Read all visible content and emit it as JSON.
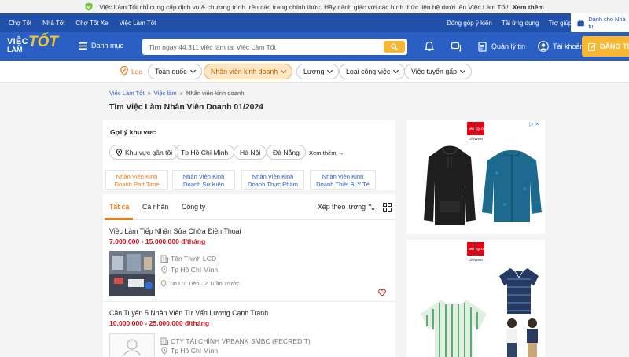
{
  "banner": {
    "text": "Việc Làm Tốt chỉ cung cấp dịch vụ & chương trình trên các trang chính thức. Hãy cảnh giác với các hình thức liên hệ dưới tên Việc Làm Tốt!",
    "more": "Xem thêm"
  },
  "topnav": {
    "left": [
      "Chợ Tốt",
      "Nhà Tốt",
      "Chợ Tốt Xe",
      "Việc Làm Tốt"
    ],
    "right": [
      "Đóng góp ý kiến",
      "Tải ứng dụng",
      "Trợ giúp"
    ],
    "employer": "Dành cho Nhà tu"
  },
  "header": {
    "logo_a": "VIỆC",
    "logo_b": "LÀM",
    "logo_c": "TỐT",
    "menu": "Danh mục",
    "search_placeholder": "Tìm ngay 44.311 việc làm tại Việc Làm Tốt",
    "manage": "Quản lý tin",
    "account": "Tài khoản",
    "post": "ĐĂNG TI"
  },
  "filters": {
    "location_label": "Lọc",
    "chips": [
      "Toàn quốc",
      "Nhân viên kinh doanh",
      "Lương",
      "Loại công việc",
      "Việc tuyển gấp"
    ]
  },
  "breadcrumb": [
    "Việc Làm Tốt",
    "Việc làm",
    "Nhân viên kinh doanh"
  ],
  "page_title": "Tìm Việc Làm Nhân Viên Doanh 01/2024",
  "suggest": {
    "heading": "Gợi ý khu vực",
    "regions": [
      "Khu vực gần tôi",
      "Tp Hồ Chí Minh",
      "Hà Nội",
      "Đà Nẵng"
    ],
    "more": "Xem thêm",
    "cards": [
      {
        "l1": "Nhân Viên Kinh",
        "l2": "Doanh Part Time"
      },
      {
        "l1": "Nhân Viên Kinh",
        "l2": "Doanh Sự Kiện"
      },
      {
        "l1": "Nhân Viên Kinh",
        "l2": "Doanh Thực Phẩm"
      },
      {
        "l1": "Nhân Viên Kinh",
        "l2": "Doanh Thiết Bị Y Tế"
      }
    ]
  },
  "tabs": [
    "Tất cả",
    "Cá nhân",
    "Công ty"
  ],
  "sort_label": "Xếp theo lương",
  "jobs": [
    {
      "title": "Việc Làm Tiếp Nhận Sửa Chữa Điện Thoại",
      "salary": "7.000.000 - 15.000.000 đ/tháng",
      "company": "Tân Thịnh LCD",
      "location": "Tp Hồ Chí Minh",
      "meta": "Tin Ưu Tiên · 2 Tuần Trước"
    },
    {
      "title": "Cần Tuyển 5 Nhân Viên Tư Vấn Lương Cạnh Tranh",
      "salary": "10.000.000 - 25.000.000 đ/tháng",
      "company": "CTY TÀI CHÍNH VPBANK SMBC (FECREDIT)",
      "location": "Tp Hồ Chí Minh"
    }
  ],
  "ads": {
    "brand_1": "UNI",
    "brand_2": "QLO",
    "tagline": "LifeWear"
  },
  "colors": {
    "brand_blue": "#2a5fc4",
    "accent_orange": "#f07b14",
    "salary_red": "#c8161e",
    "cta_yellow": "#f7b733"
  }
}
